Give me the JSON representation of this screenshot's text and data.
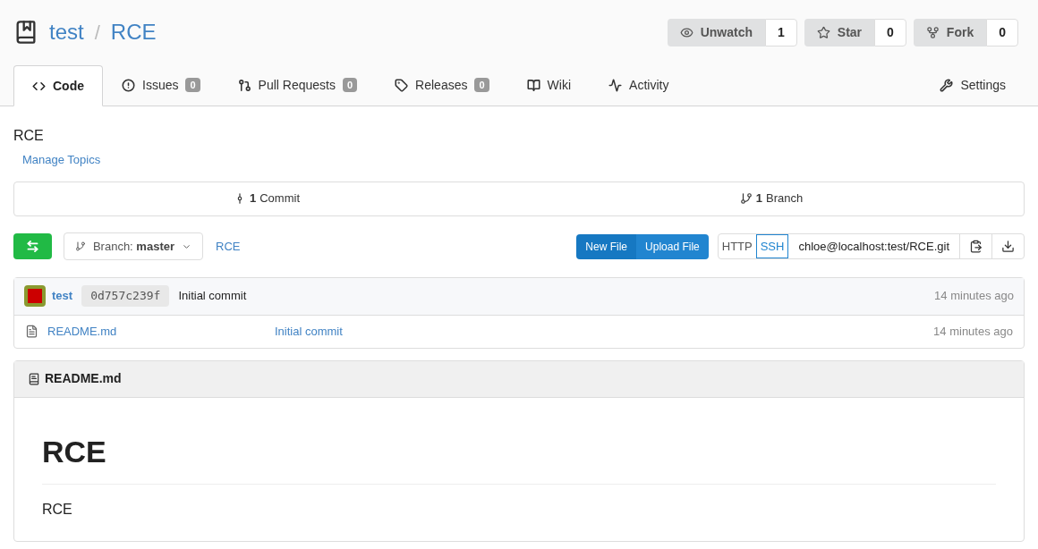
{
  "repo": {
    "owner": "test",
    "separator": "/",
    "name": "RCE"
  },
  "actions": [
    {
      "label": "Unwatch",
      "count": "1"
    },
    {
      "label": "Star",
      "count": "0"
    },
    {
      "label": "Fork",
      "count": "0"
    }
  ],
  "tabs": [
    {
      "label": "Code",
      "selected": true
    },
    {
      "label": "Issues",
      "count": "0",
      "selected": false
    },
    {
      "label": "Pull Requests",
      "count": "0",
      "selected": false
    },
    {
      "label": "Releases",
      "count": "0",
      "selected": false
    },
    {
      "label": "Wiki",
      "selected": false
    },
    {
      "label": "Activity",
      "selected": false
    }
  ],
  "settings_tab": {
    "label": "Settings",
    "selected": false
  },
  "description": "RCE",
  "manage_topics": "Manage Topics",
  "stats": [
    {
      "count": "1",
      "label": "Commit"
    },
    {
      "count": "1",
      "label": "Branch"
    }
  ],
  "branch": {
    "prefix": "Branch:",
    "name": "master"
  },
  "path": "RCE",
  "file_buttons": [
    "New File",
    "Upload File"
  ],
  "clone": {
    "protocols": [
      {
        "label": "HTTP",
        "selected": false
      },
      {
        "label": "SSH",
        "selected": true
      }
    ],
    "url": "chloe@localhost:test/RCE.git"
  },
  "last_commit": {
    "author": "test",
    "sha": "0d757c239f",
    "message": "Initial commit",
    "time": "14 minutes ago"
  },
  "files": [
    {
      "name": "README.md",
      "commit": "Initial commit",
      "time": "14 minutes ago"
    }
  ],
  "readme": {
    "title": "README.md",
    "heading": "RCE",
    "body": "RCE"
  }
}
